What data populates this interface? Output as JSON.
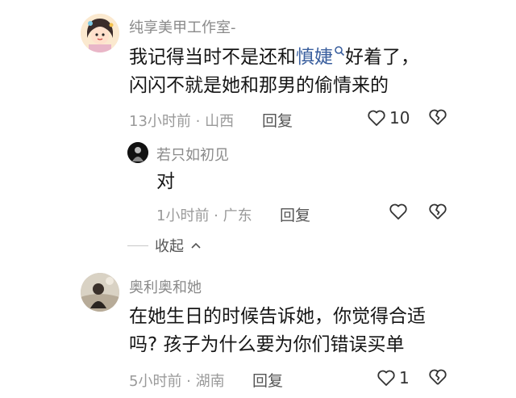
{
  "comments": [
    {
      "username": "纯享美甲工作室-",
      "text_line1_before": "我记得当时不是还和",
      "mention": "慎婕",
      "text_line1_after": "好着了，",
      "text_line2": "闪闪不就是她和那男的偷情来的",
      "meta": "13小时前 · 山西",
      "reply_label": "回复",
      "like_count": "10"
    },
    {
      "username": "若只如初见",
      "text": "对",
      "meta": "1小时前 · 广东",
      "reply_label": "回复"
    },
    {
      "username": "奥利奥和她",
      "text_line1": "在她生日的时候告诉她，你觉得合适",
      "text_line2": "吗? 孩子为什么要为你们错误买单",
      "meta": "5小时前 · 湖南",
      "reply_label": "回复",
      "like_count": "1"
    }
  ],
  "collapse_label": "收起",
  "icons": {
    "like": "heart-outline-icon",
    "dislike": "broken-heart-icon",
    "search": "search-icon",
    "chevron": "chevron-up-icon"
  },
  "colors": {
    "mention": "#3a5f9e",
    "meta": "#9a9a9a"
  }
}
